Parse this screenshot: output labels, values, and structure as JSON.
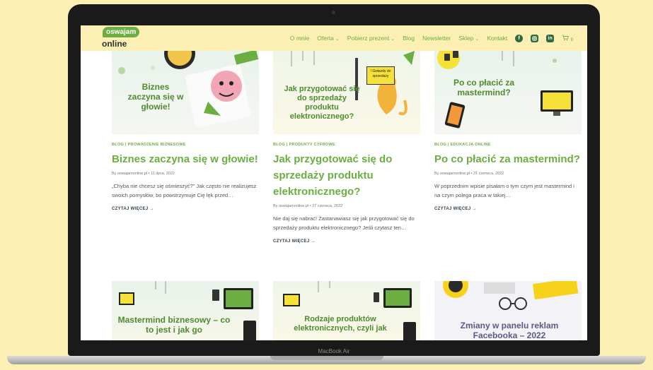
{
  "device": {
    "label": "MacBook Air"
  },
  "header": {
    "logo_top": "oswajam",
    "logo_bottom": "online",
    "nav": [
      {
        "label": "O mnie",
        "dropdown": false
      },
      {
        "label": "Oferta",
        "dropdown": true
      },
      {
        "label": "Pobierz prezent",
        "dropdown": true
      },
      {
        "label": "Blog",
        "dropdown": false
      },
      {
        "label": "Newsletter",
        "dropdown": false
      },
      {
        "label": "Sklep",
        "dropdown": true
      },
      {
        "label": "Kontakt",
        "dropdown": false
      }
    ],
    "social": [
      "facebook-icon",
      "instagram-icon",
      "linkedin-icon"
    ],
    "cart_count": "0"
  },
  "posts": [
    {
      "thumb_text": "Biznes zaczyna się w głowie!",
      "category": "BLOG | PROWADZENIE BIZNESOWE",
      "title": "Biznes zaczyna się w głowie!",
      "meta": "By oswajamonline.pl • 11 lipca, 2022",
      "excerpt": "„Chyba nie chcesz się ośmieszyć?\" Jak często nie realizujesz swoich pomysłów, bo powstrzymuje Cię lęk przed…",
      "more": "CZYTAJ WIĘCEJ →"
    },
    {
      "thumb_text": "Jak przygotować się do sprzedaży produktu elektronicznego?",
      "sign_text": "! Gwiazdy do sprzedaży",
      "category": "BLOG | PRODUKTY CYFROWE",
      "title": "Jak przygotować się do sprzedaży produktu elektronicznego?",
      "meta": "By oswajamonline.pl • 27 czerwca, 2022",
      "excerpt": "Nie daj się nabrać! Zastanawiasz się jak przygotować się do sprzedaży produktu elektronicznego? Jeśli czytasz ten…",
      "more": "CZYTAJ WIĘCEJ →"
    },
    {
      "thumb_text": "Po co płacić za mastermind?",
      "category": "BLOG | EDUKACJA ONLINE",
      "title": "Po co płacić za mastermind?",
      "meta": "By oswajamonline.pl • 21 czerwca, 2022",
      "excerpt": "W poprzednim wpisie pisałam o tym czym jest mastermind i na czym polega praca w takiej…",
      "more": "CZYTAJ WIĘCEJ →"
    }
  ],
  "bottom_posts": [
    {
      "thumb_text": "Mastermind biznesowy – co to jest i jak go"
    },
    {
      "thumb_text": "Rodzaje produktów elektronicznych, czyli jak"
    },
    {
      "thumb_text": "Zmiany w panelu reklam Facebooka – 2022"
    }
  ],
  "colors": {
    "brand_green": "#6cae42",
    "header_bg": "#fcefb4"
  }
}
